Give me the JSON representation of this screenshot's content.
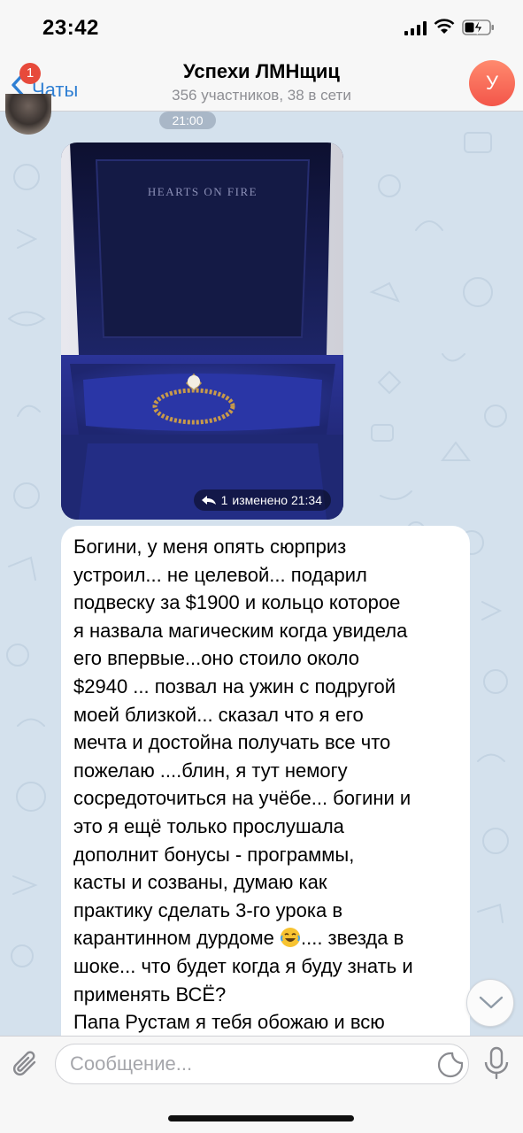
{
  "status_bar": {
    "time": "23:42",
    "icons": [
      "signal-icon",
      "wifi-icon",
      "battery-charging-icon"
    ]
  },
  "header": {
    "back_label": "Чаты",
    "unread_count": "1",
    "title": "Успехи ЛМНщиц",
    "subtitle": "356 участников, 38 в сети",
    "avatar_letter": "У",
    "avatar_color": "#f3564a",
    "accent_color": "#2f7fd3"
  },
  "messages": {
    "date_pill": "21:00",
    "photo": {
      "box_brand": "HEARTS ON FIRE",
      "reply_count": "1",
      "meta": "изменено 21:34"
    },
    "text_lines": [
      "Богини, у меня опять сюрприз",
      "устроил... не целевой... подарил",
      "подвеску за $1900 и кольцо которое",
      "я назвала магическим когда увидела",
      "его впервые...оно стоило около",
      "$2940 ... позвал на ужин с подругой",
      "моей близкой... сказал что я его",
      "мечта и достойна получать все что",
      "пожелаю ....блин, я тут немогу",
      "сосредоточиться на учёбе... богини и",
      "это я ещё только прослушала",
      "дополнит бонусы - программы,",
      "касты и созваны, думаю как",
      "практику сделать 3-го урока в",
      "карантинном дурдоме",
      ".... звезда в",
      "шоке... что будет когда я буду знать и",
      "применять ВСЁ?",
      "Папа Рустам я тебя обожаю и всю"
    ]
  },
  "input_bar": {
    "placeholder": "Сообщение..."
  }
}
